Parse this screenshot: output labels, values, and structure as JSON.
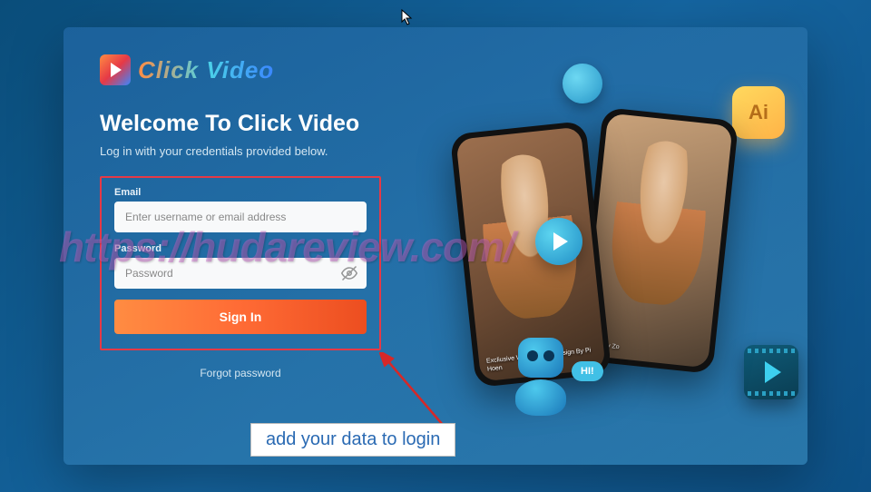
{
  "logo": {
    "text": "Click Video"
  },
  "header": {
    "title": "Welcome To Click Video",
    "subtitle": "Log in with your credentials provided below."
  },
  "form": {
    "email_label": "Email",
    "email_placeholder": "Enter username or email address",
    "password_label": "Password",
    "password_placeholder": "Password",
    "signin_label": "Sign In"
  },
  "forgot_label": "Forgot password",
  "illustration": {
    "ai_label": "Ai",
    "hi_label": "HI!",
    "phone1_caption": "Excliusive Women Dres\nDesign By Pi Hoen",
    "phone2_caption": "Ttfit by Zo"
  },
  "watermark_text": "https://hudareview.com/",
  "callout_text": "add your data to login"
}
